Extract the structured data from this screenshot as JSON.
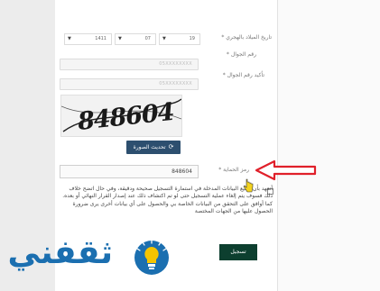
{
  "form": {
    "birth_date_label": "تاريخ الميلاد بالهجري *",
    "birth_date": {
      "day": "19",
      "month": "07",
      "year": "1411"
    },
    "mobile_label": "رقم الجوال *",
    "mobile_value": "05XXXXXXXX",
    "mobile_confirm_label": "تأكيد رقم الجوال *",
    "mobile_confirm_value": "05XXXXXXXX",
    "captcha_image_text": "848604",
    "refresh_button_label": "تحديث الصورة",
    "captcha_label": "رمز الحماية *",
    "captcha_value": "848604",
    "terms_text": "أتعهد بأن جميع البيانات المدخلة في استمارة التسجيل صحيحة ودقيقة، وفي حال اتضح خلاف ذلك فسوف يتم إلغاء عملية التسجيل حتى لو تم اكتشاف ذلك عند إصدار القرار النهائي أو بعده. كما أوافق على التحقق من البيانات الخاصة بي والحصول على أي بيانات أخرى يرى ضرورة الحصول عليها من الجهات المختصة",
    "register_button_label": "تسجيل"
  },
  "logo": {
    "text": "ثقفني"
  },
  "colors": {
    "primary": "#2d4f6f",
    "register": "#0d3f2f",
    "annotation_arrow": "#e0202a",
    "logo_blue": "#1b6fb0",
    "logo_yellow": "#f5c400"
  },
  "icons": {
    "refresh": "refresh-icon",
    "dropdown": "caret-down-icon",
    "bulb": "lightbulb-icon",
    "cursor": "mouse-cursor-icon"
  }
}
